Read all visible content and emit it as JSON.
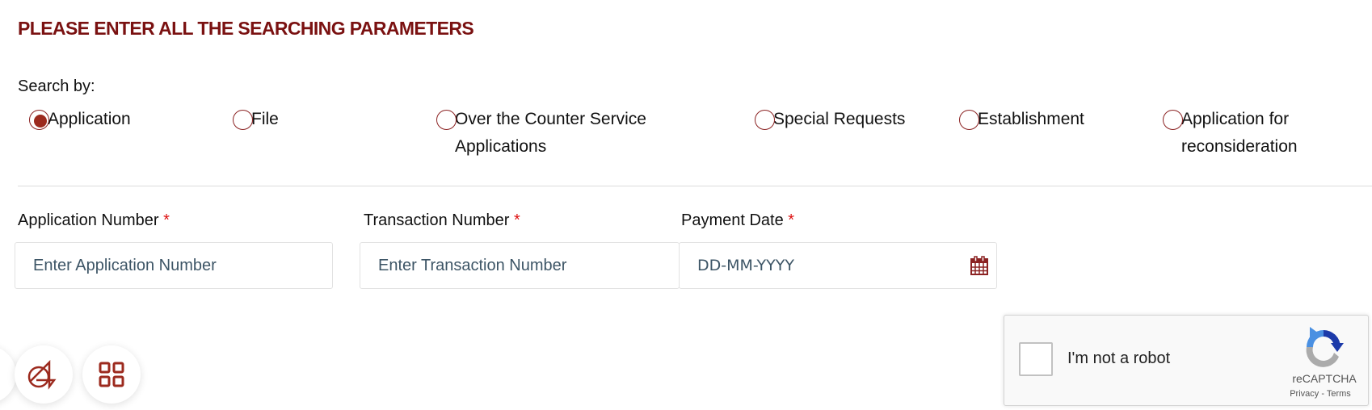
{
  "header": {
    "title": "PLEASE ENTER ALL THE SEARCHING PARAMETERS"
  },
  "search_by": {
    "label": "Search by:",
    "options": [
      {
        "label_line1": "Application",
        "label_line2": "",
        "checked": true
      },
      {
        "label_line1": "File",
        "label_line2": "",
        "checked": false
      },
      {
        "label_line1": "Over the Counter Service",
        "label_line2": "Applications",
        "checked": false
      },
      {
        "label_line1": "Special Requests",
        "label_line2": "",
        "checked": false
      },
      {
        "label_line1": "Establishment",
        "label_line2": "",
        "checked": false
      },
      {
        "label_line1": "Application for",
        "label_line2": "reconsideration",
        "checked": false
      }
    ]
  },
  "fields": {
    "application_number": {
      "label": "Application Number",
      "required_mark": "*",
      "placeholder": "Enter Application Number",
      "value": ""
    },
    "transaction_number": {
      "label": "Transaction Number",
      "required_mark": "*",
      "placeholder": "Enter Transaction Number",
      "value": ""
    },
    "payment_date": {
      "label": "Payment Date",
      "required_mark": "*",
      "placeholder": "DD-MM-YYYY",
      "value": "",
      "icon": "calendar-icon"
    }
  },
  "recaptcha": {
    "checkbox_label": "I'm not a robot",
    "brand": "reCAPTCHA",
    "privacy": "Privacy",
    "separator": " - ",
    "terms": "Terms"
  },
  "floating_buttons": [
    {
      "icon": "accessibility-logo-icon"
    },
    {
      "icon": "grid-apps-icon"
    }
  ],
  "colors": {
    "brand": "#7a1111",
    "radio": "#9c2a1e",
    "required": "#dd1111"
  }
}
